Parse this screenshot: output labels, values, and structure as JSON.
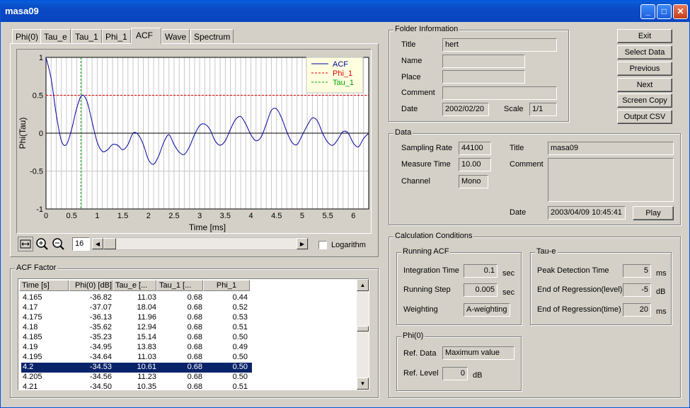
{
  "window": {
    "title": "masa09"
  },
  "tabs": [
    "Phi(0)",
    "Tau_e",
    "Tau_1",
    "Phi_1",
    "ACF",
    "Wave",
    "Spectrum"
  ],
  "active_tab": "ACF",
  "chart_data": {
    "type": "line",
    "xlabel": "Time [ms]",
    "ylabel": "Phi(Tau)",
    "xlim": [
      0,
      6.3
    ],
    "ylim": [
      -1,
      1
    ],
    "x_ticks": [
      "0",
      "0.5",
      "1",
      "1.5",
      "2",
      "2.5",
      "3",
      "3.5",
      "4",
      "4.5",
      "5",
      "5.5",
      "6"
    ],
    "y_ticks": [
      "1",
      "0.5",
      "0",
      "-0.5",
      "-1"
    ],
    "legend": [
      "ACF",
      "Phi_1",
      "Tau_1"
    ],
    "legend_position": "top-right",
    "series": [
      {
        "name": "ACF",
        "color": "#0000a0",
        "x": [
          0,
          0.1,
          0.2,
          0.3,
          0.4,
          0.5,
          0.6,
          0.7,
          0.8,
          0.9,
          1.0,
          1.1,
          1.2,
          1.3,
          1.4,
          1.5,
          1.6,
          1.7,
          1.8,
          1.9,
          2.0,
          2.1,
          2.2,
          2.3,
          2.4,
          2.5,
          2.6,
          2.7,
          2.8,
          2.9,
          3.0,
          3.1,
          3.2,
          3.3,
          3.4,
          3.5,
          3.6,
          3.7,
          3.8,
          3.9,
          4.0,
          4.1,
          4.2,
          4.3,
          4.4,
          4.5,
          4.6,
          4.7,
          4.8,
          4.9,
          5.0,
          5.1,
          5.2,
          5.3,
          5.4,
          5.5,
          5.6,
          5.7,
          5.8,
          5.9,
          6.0,
          6.1,
          6.2,
          6.3
        ],
        "y": [
          1.0,
          0.72,
          0.25,
          -0.1,
          -0.15,
          0.05,
          0.33,
          0.5,
          0.42,
          0.15,
          -0.12,
          -0.24,
          -0.22,
          -0.15,
          -0.16,
          -0.22,
          -0.15,
          0.0,
          -0.02,
          -0.15,
          -0.35,
          -0.41,
          -0.3,
          -0.12,
          -0.02,
          -0.15,
          -0.25,
          -0.28,
          -0.18,
          -0.02,
          0.1,
          0.12,
          0.05,
          -0.1,
          -0.16,
          -0.1,
          0.05,
          0.18,
          0.22,
          0.12,
          -0.02,
          -0.1,
          -0.05,
          0.12,
          0.3,
          0.32,
          0.2,
          0.02,
          -0.12,
          -0.15,
          -0.03,
          0.1,
          0.2,
          0.16,
          0.0,
          -0.12,
          -0.16,
          -0.08,
          0.02,
          0.0,
          -0.13,
          -0.18,
          -0.07,
          0.0
        ]
      },
      {
        "name": "Phi_1",
        "color": "#e00000",
        "y_const": 0.5
      },
      {
        "name": "Tau_1",
        "color": "#00a000",
        "x_const": 0.68
      }
    ]
  },
  "chart_toolbar": {
    "zoom_value": "16",
    "log_label": "Logarithm"
  },
  "acf_factor": {
    "title": "ACF Factor",
    "columns": [
      "Time [s]",
      "Phi(0) [dB]",
      "Tau_e [...",
      "Tau_1 [...",
      "Phi_1"
    ],
    "rows": [
      [
        "4.165",
        "-36.82",
        "11.03",
        "0.68",
        "0.44"
      ],
      [
        "4.17",
        "-37.07",
        "18.04",
        "0.68",
        "0.52"
      ],
      [
        "4.175",
        "-36.13",
        "11.96",
        "0.68",
        "0.53"
      ],
      [
        "4.18",
        "-35.62",
        "12.94",
        "0.68",
        "0.51"
      ],
      [
        "4.185",
        "-35.23",
        "15.14",
        "0.68",
        "0.50"
      ],
      [
        "4.19",
        "-34.95",
        "13.83",
        "0.68",
        "0.49"
      ],
      [
        "4.195",
        "-34.64",
        "11.03",
        "0.68",
        "0.50"
      ],
      [
        "4.2",
        "-34.53",
        "10.61",
        "0.68",
        "0.50"
      ],
      [
        "4.205",
        "-34.56",
        "11.23",
        "0.68",
        "0.50"
      ],
      [
        "4.21",
        "-34.50",
        "10.35",
        "0.68",
        "0.51"
      ]
    ],
    "selected_index": 7
  },
  "folder": {
    "title": "Folder Information",
    "title_label": "Title",
    "title_value": "hert",
    "name_label": "Name",
    "place_label": "Place",
    "comment_label": "Comment",
    "date_label": "Date",
    "date_value": "2002/02/20",
    "scale_label": "Scale",
    "scale_value": "1/1"
  },
  "buttons": {
    "exit": "Exit",
    "select_data": "Select Data",
    "previous": "Previous",
    "next": "Next",
    "screen_copy": "Screen Copy",
    "output_csv": "Output CSV"
  },
  "data": {
    "title": "Data",
    "sampling_label": "Sampling Rate",
    "sampling_value": "44100",
    "measure_label": "Measure Time",
    "measure_value": "10.00",
    "channel_label": "Channel",
    "channel_value": "Mono",
    "title_label": "Title",
    "title_value": "masa09",
    "comment_label": "Comment",
    "date_label": "Date",
    "date_value": "2003/04/09 10:45:41",
    "play": "Play"
  },
  "calc": {
    "title": "Calculation Conditions",
    "running": {
      "title": "Running ACF",
      "integration_label": "Integration Time",
      "integration_value": "0.1",
      "integration_unit": "sec",
      "step_label": "Running Step",
      "step_value": "0.005",
      "step_unit": "sec",
      "weighting_label": "Weighting",
      "weighting_value": "A-weighting"
    },
    "taue": {
      "title": "Tau-e",
      "peak_label": "Peak Detection Time",
      "peak_value": "5",
      "peak_unit": "ms",
      "endlevel_label": "End of Regression(level)",
      "endlevel_value": "-5",
      "endlevel_unit": "dB",
      "endtime_label": "End of Regression(time)",
      "endtime_value": "20",
      "endtime_unit": "ms"
    },
    "phi0": {
      "title": "Phi(0)",
      "refdata_label": "Ref. Data",
      "refdata_value": "Maximum value",
      "reflevel_label": "Ref. Level",
      "reflevel_value": "0",
      "reflevel_unit": "dB"
    }
  }
}
